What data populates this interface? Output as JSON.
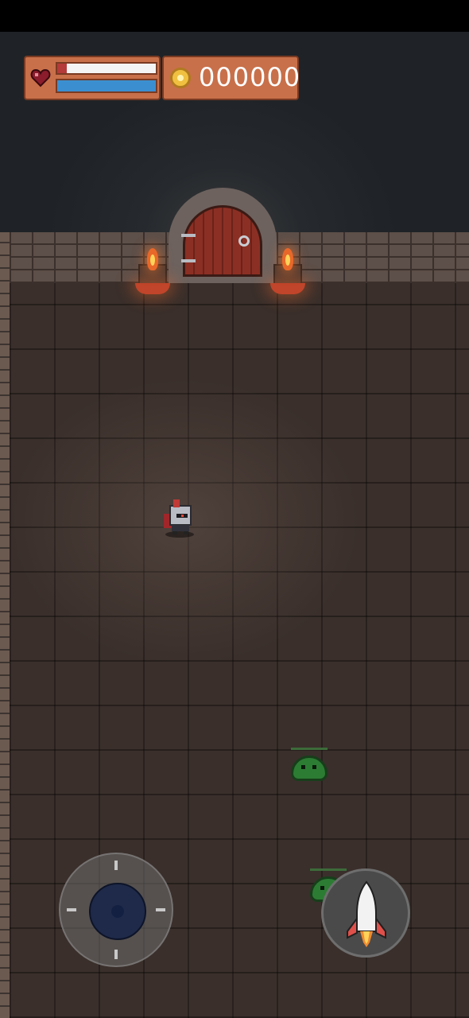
{
  "hud": {
    "health_fraction": 0.9,
    "mana_fraction": 1.0,
    "coins": "000000"
  },
  "icons": {
    "health": "heart-icon",
    "coins": "coin-icon",
    "fire": "rocket-icon",
    "movement": "joystick-icon"
  },
  "colors": {
    "hud_panel": "#c8704a",
    "health_bar": "#f4f4f4",
    "mana_bar": "#3b8fd0",
    "floor": "#3a2f2b",
    "slime": "#2d7c34"
  }
}
